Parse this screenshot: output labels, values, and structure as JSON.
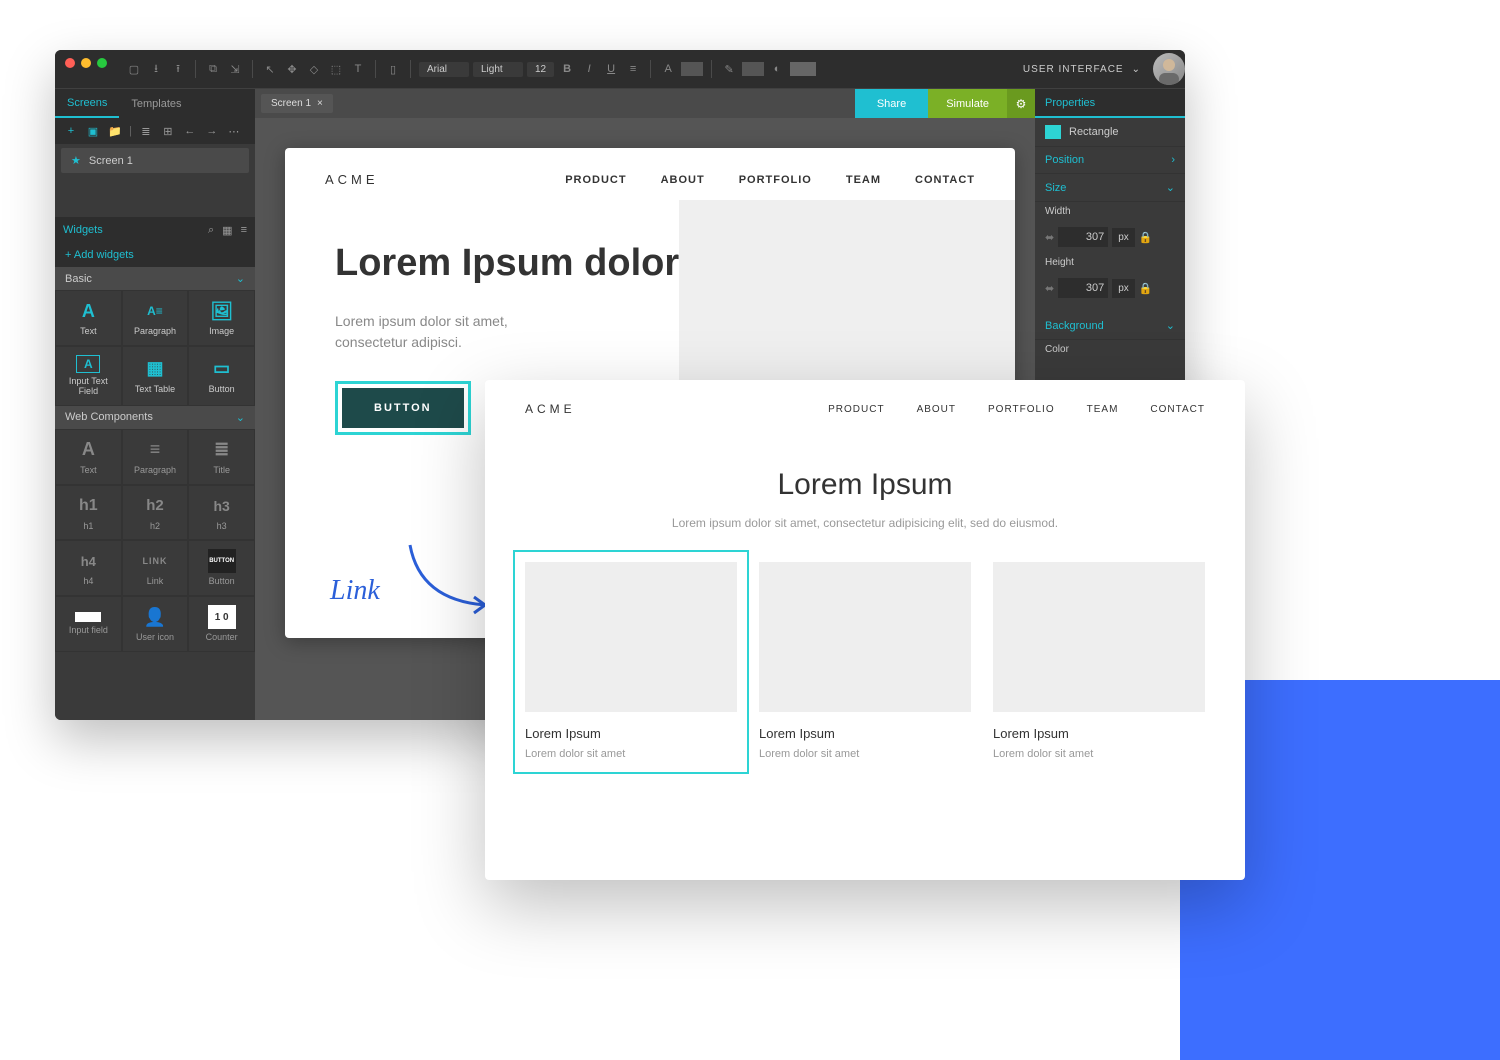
{
  "topbar": {
    "font": "Arial",
    "weight": "Light",
    "size": "12",
    "user_label": "USER INTERFACE"
  },
  "tabs": {
    "screens": "Screens",
    "templates": "Templates",
    "canvas_tab": "Screen 1"
  },
  "actions": {
    "share": "Share",
    "simulate": "Simulate"
  },
  "sidebar_l": {
    "screen1": "Screen 1",
    "widgets": "Widgets",
    "add": "+ Add widgets",
    "basic": "Basic",
    "webcomp": "Web Components",
    "items_basic": [
      {
        "l": "Text"
      },
      {
        "l": "Paragraph"
      },
      {
        "l": "Image"
      },
      {
        "l": "Input Text Field"
      },
      {
        "l": "Text Table"
      },
      {
        "l": "Button"
      }
    ],
    "items_web": [
      {
        "l": "Text"
      },
      {
        "l": "Paragraph"
      },
      {
        "l": "Title"
      },
      {
        "l": "h1"
      },
      {
        "l": "h2"
      },
      {
        "l": "h3"
      },
      {
        "l": "h4"
      },
      {
        "l": "Link"
      },
      {
        "l": "Button"
      },
      {
        "l": "Input field"
      },
      {
        "l": "User icon"
      },
      {
        "l": "Counter"
      }
    ]
  },
  "sidebar_r": {
    "properties": "Properties",
    "rectangle": "Rectangle",
    "position": "Position",
    "size": "Size",
    "width_l": "Width",
    "width_v": "307",
    "height_l": "Height",
    "height_v": "307",
    "unit": "px",
    "background": "Background",
    "color": "Color"
  },
  "screen": {
    "logo": "ACME",
    "nav": [
      "PRODUCT",
      "ABOUT",
      "PORTFOLIO",
      "TEAM",
      "CONTACT"
    ],
    "headline": "Lorem Ipsum dolor sit",
    "sub": "Lorem ipsum dolor sit amet, consectetur adipisci.",
    "button": "BUTTON"
  },
  "preview": {
    "logo": "ACME",
    "nav": [
      "PRODUCT",
      "ABOUT",
      "PORTFOLIO",
      "TEAM",
      "CONTACT"
    ],
    "title": "Lorem Ipsum",
    "sub": "Lorem ipsum dolor sit amet, consectetur adipisicing elit, sed do eiusmod.",
    "cards": [
      {
        "t": "Lorem Ipsum",
        "d": "Lorem dolor sit amet"
      },
      {
        "t": "Lorem Ipsum",
        "d": "Lorem dolor sit amet"
      },
      {
        "t": "Lorem Ipsum",
        "d": "Lorem dolor sit amet"
      }
    ]
  },
  "link_label": "Link"
}
